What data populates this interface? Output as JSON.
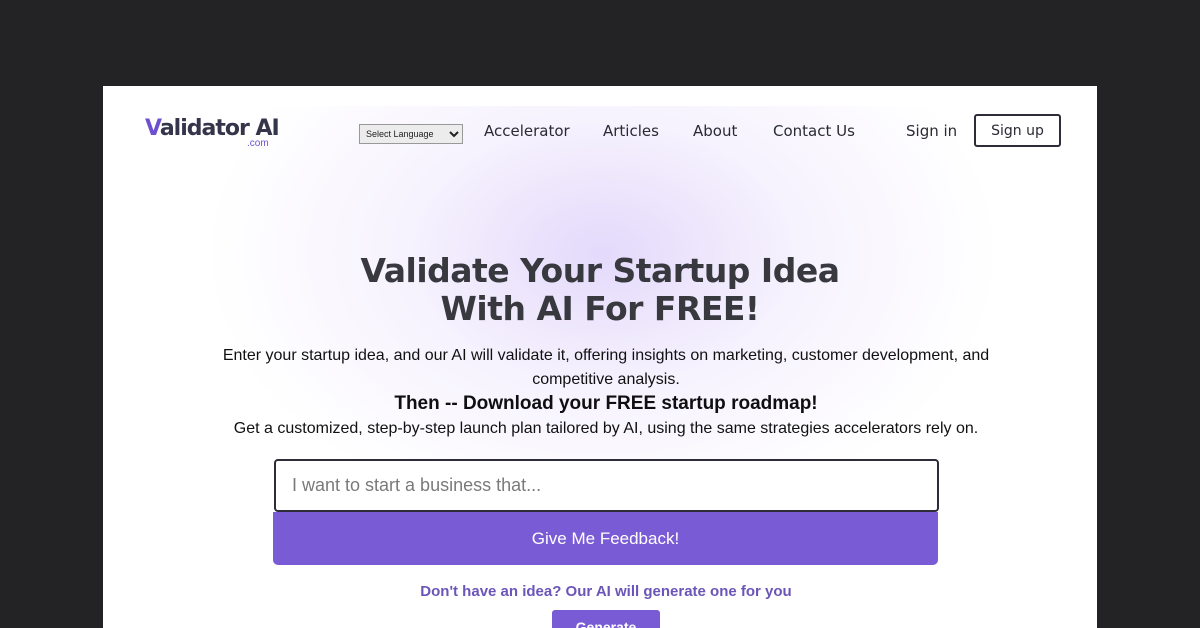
{
  "brand": {
    "name_v": "V",
    "name_rest": "alidator AI",
    "domain": ".com"
  },
  "nav": {
    "language_select": {
      "selected": "Select Language"
    },
    "links": [
      "Accelerator",
      "Articles",
      "About",
      "Contact Us"
    ],
    "sign_in": "Sign in",
    "sign_up": "Sign up"
  },
  "hero": {
    "headline_line1": "Validate Your Startup Idea",
    "headline_line2": "With AI For FREE!",
    "subtitle": "Enter your startup idea, and our AI will validate it, offering insights on marketing, customer development, and competitive analysis.",
    "roadmap": "Then -- Download your FREE startup roadmap!",
    "tailored": "Get a customized, step-by-step launch plan tailored by AI, using the same strategies accelerators rely on."
  },
  "form": {
    "idea_placeholder": "I want to start a business that...",
    "idea_value": "",
    "feedback_button": "Give Me Feedback!",
    "no_idea_text": "Don't have an idea? Our AI will generate one for you",
    "generate_button": "Generate"
  },
  "colors": {
    "accent": "#7a5bd6",
    "background": "#232326",
    "text_dark": "#38383f"
  }
}
